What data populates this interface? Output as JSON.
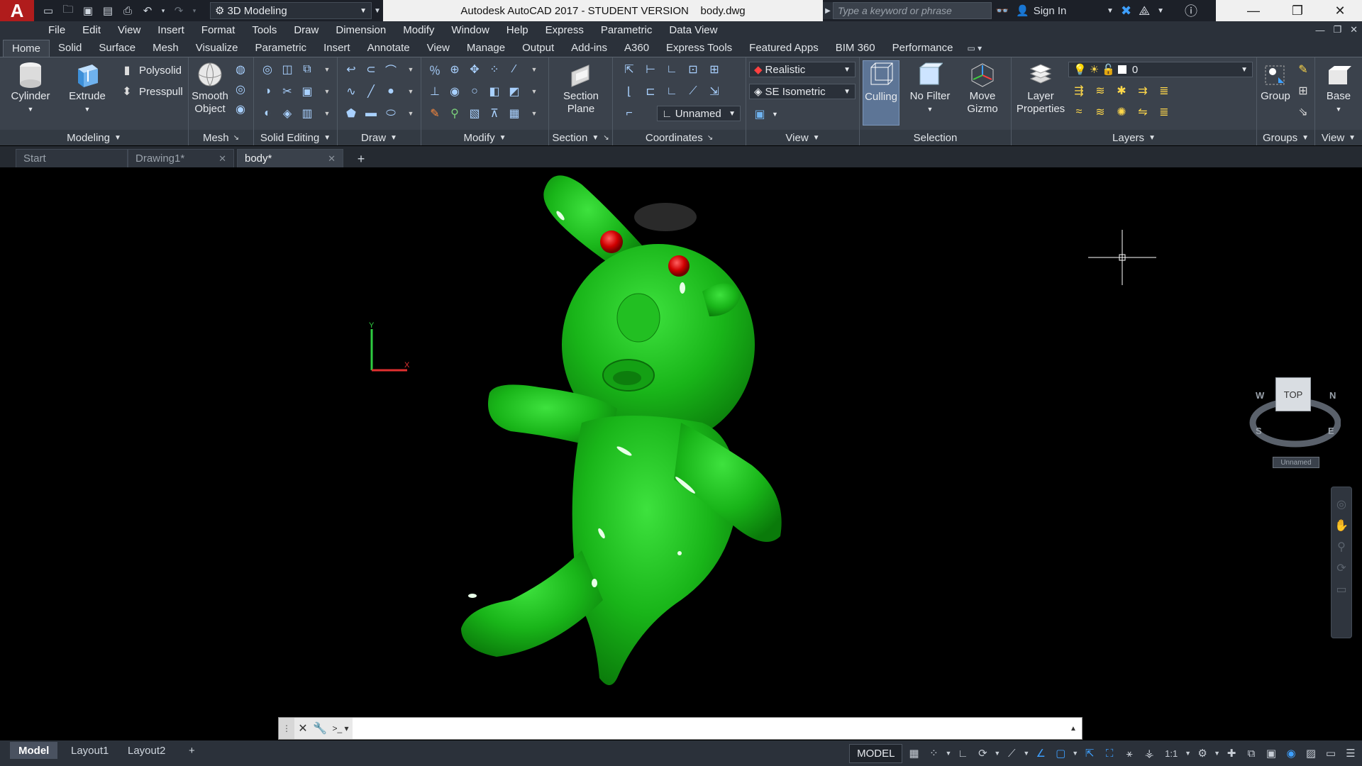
{
  "titlebar": {
    "app_logo": "A",
    "workspace": "3D Modeling",
    "title": "Autodesk AutoCAD 2017 - STUDENT VERSION    body.dwg",
    "search_placeholder": "Type a keyword or phrase",
    "signin": "Sign In"
  },
  "menu": [
    "File",
    "Edit",
    "View",
    "Insert",
    "Format",
    "Tools",
    "Draw",
    "Dimension",
    "Modify",
    "Window",
    "Help",
    "Express",
    "Parametric",
    "Data View"
  ],
  "ribbon_tabs": [
    "Home",
    "Solid",
    "Surface",
    "Mesh",
    "Visualize",
    "Parametric",
    "Insert",
    "Annotate",
    "View",
    "Manage",
    "Output",
    "Add-ins",
    "A360",
    "Express Tools",
    "Featured Apps",
    "BIM 360",
    "Performance"
  ],
  "ribbon": {
    "modeling": {
      "title": "Modeling",
      "cylinder": "Cylinder",
      "extrude": "Extrude",
      "polysolid": "Polysolid",
      "presspull": "Presspull"
    },
    "mesh": {
      "title": "Mesh",
      "smooth": "Smooth\nObject"
    },
    "solid_editing": {
      "title": "Solid Editing"
    },
    "draw": {
      "title": "Draw"
    },
    "modify": {
      "title": "Modify"
    },
    "section": {
      "title": "Section",
      "section_plane": "Section\nPlane"
    },
    "coordinates": {
      "title": "Coordinates",
      "ucs": "Unnamed"
    },
    "view": {
      "title": "View",
      "visual_style": "Realistic",
      "view_dir": "SE Isometric"
    },
    "selection": {
      "title": "Selection",
      "culling": "Culling",
      "no_filter": "No Filter",
      "move_gizmo": "Move\nGizmo"
    },
    "layers": {
      "title": "Layers",
      "layer_props": "Layer\nProperties",
      "current_layer": "0"
    },
    "groups": {
      "title": "Groups",
      "group": "Group"
    },
    "view2": {
      "title": "View",
      "base": "Base"
    }
  },
  "doc_tabs": [
    {
      "label": "Start"
    },
    {
      "label": "Drawing1*"
    },
    {
      "label": "body*"
    }
  ],
  "viewcube": {
    "top_label": "TOP",
    "n": "N",
    "s": "S",
    "e": "E",
    "w": "W",
    "ucs_name": "Unnamed"
  },
  "status": {
    "layouts": [
      "Model",
      "Layout1",
      "Layout2"
    ],
    "model_space": "MODEL",
    "scale": "1:1"
  },
  "colors": {
    "accent": "#3ea0ff",
    "model_green": "#1fb81f",
    "eyes": "#cc0000",
    "hair": "#2a2a2a"
  }
}
